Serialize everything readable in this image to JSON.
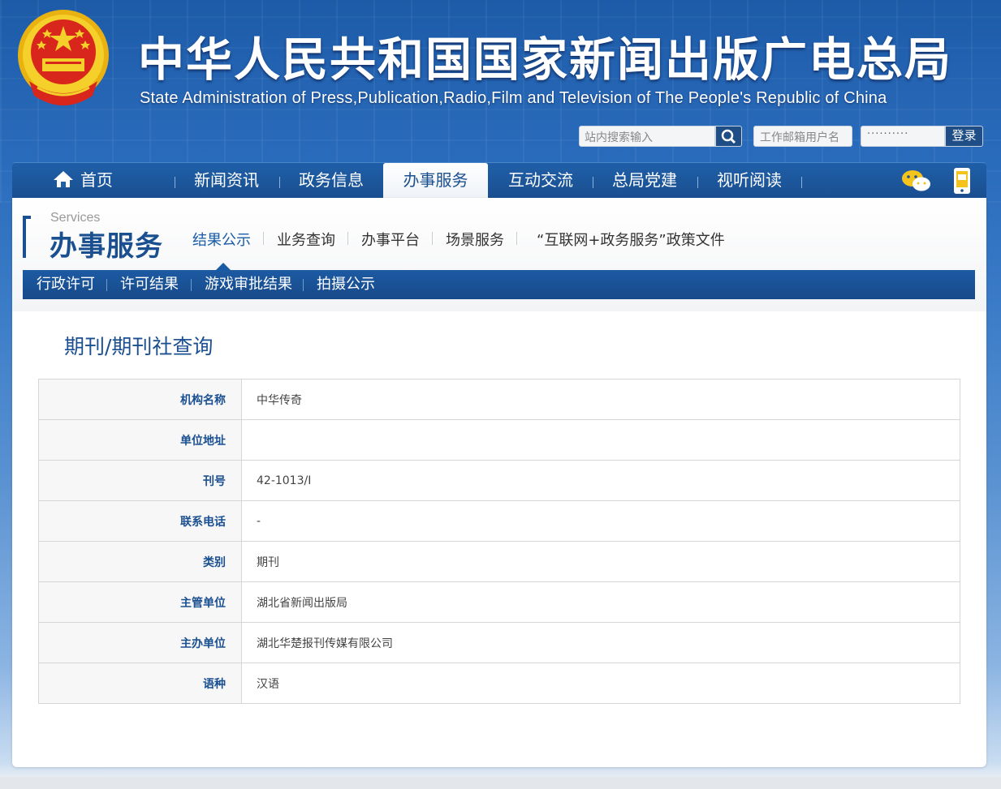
{
  "header": {
    "title": "中华人民共和国国家新闻出版广电总局",
    "subtitle": "State Administration of Press,Publication,Radio,Film and Television of The People's Republic of China",
    "emblem_icon": "national-emblem-icon"
  },
  "search": {
    "placeholder": "站内搜索输入",
    "button_icon": "search-icon"
  },
  "login": {
    "email_placeholder": "工作邮箱用户名",
    "password_mask": "··········",
    "login_label": "登录"
  },
  "nav": {
    "home_icon": "home-icon",
    "items": [
      "首页",
      "新闻资讯",
      "政务信息",
      "办事服务",
      "互动交流",
      "总局党建",
      "视听阅读"
    ],
    "active": "办事服务",
    "wechat_icon": "wechat-icon",
    "mobile_icon": "mobile-icon"
  },
  "section": {
    "en": "Services",
    "cn": "办事服务",
    "subnav": [
      "结果公示",
      "业务查询",
      "办事平台",
      "场景服务",
      "“互联网+政务服务”政策文件"
    ],
    "subnav_active": "结果公示",
    "tertiary": [
      "行政许可",
      "许可结果",
      "游戏审批结果",
      "拍摄公示"
    ]
  },
  "page": {
    "title": "期刊/期刊社查询",
    "rows": [
      {
        "label": "机构名称",
        "value": "中华传奇"
      },
      {
        "label": "单位地址",
        "value": ""
      },
      {
        "label": "刊号",
        "value": "42-1013/I"
      },
      {
        "label": "联系电话",
        "value": "-"
      },
      {
        "label": "类别",
        "value": "期刊"
      },
      {
        "label": "主管单位",
        "value": "湖北省新闻出版局"
      },
      {
        "label": "主办单位",
        "value": "湖北华楚报刊传媒有限公司"
      },
      {
        "label": "语种",
        "value": "汉语"
      }
    ]
  },
  "colors": {
    "brand_blue": "#1a4f90",
    "nav_blue": "#1f5fa8",
    "emblem_red": "#d9261c",
    "emblem_gold": "#f2c200"
  }
}
